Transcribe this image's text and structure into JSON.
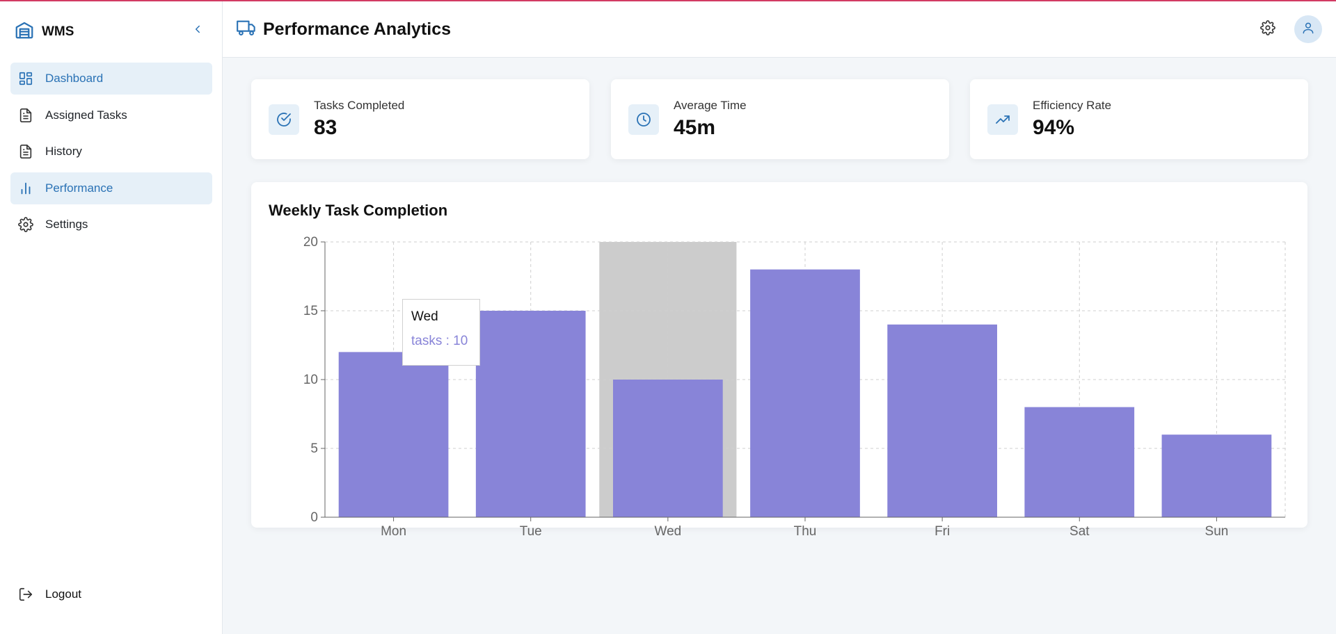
{
  "app": {
    "name": "WMS"
  },
  "sidebar": {
    "items": [
      {
        "label": "Dashboard",
        "icon": "dashboard-grid-icon",
        "active": true
      },
      {
        "label": "Assigned Tasks",
        "icon": "document-icon",
        "active": false
      },
      {
        "label": "History",
        "icon": "document-icon",
        "active": false
      },
      {
        "label": "Performance",
        "icon": "bar-chart-icon",
        "active": true
      },
      {
        "label": "Settings",
        "icon": "gear-icon",
        "active": false
      }
    ],
    "logout_label": "Logout"
  },
  "header": {
    "title": "Performance Analytics"
  },
  "stats": [
    {
      "label": "Tasks Completed",
      "value": "83",
      "icon": "check-circle-icon"
    },
    {
      "label": "Average Time",
      "value": "45m",
      "icon": "clock-icon"
    },
    {
      "label": "Efficiency Rate",
      "value": "94%",
      "icon": "trending-up-icon"
    }
  ],
  "chart": {
    "title": "Weekly Task Completion"
  },
  "chart_data": {
    "type": "bar",
    "categories": [
      "Mon",
      "Tue",
      "Wed",
      "Thu",
      "Fri",
      "Sat",
      "Sun"
    ],
    "series": [
      {
        "name": "tasks",
        "values": [
          12,
          15,
          10,
          18,
          14,
          8,
          6
        ]
      }
    ],
    "ylim": [
      0,
      20
    ],
    "yticks": [
      "0",
      "5",
      "10",
      "15",
      "20"
    ],
    "grid": true,
    "bar_color": "#8884d8",
    "highlight_category": "Wed",
    "tooltip": {
      "title": "Wed",
      "text": "tasks : 10"
    }
  },
  "colors": {
    "accent": "#2a72b5",
    "active_bg": "#e6f0f8",
    "bar": "#8884d8",
    "topline": "#d23a63"
  }
}
